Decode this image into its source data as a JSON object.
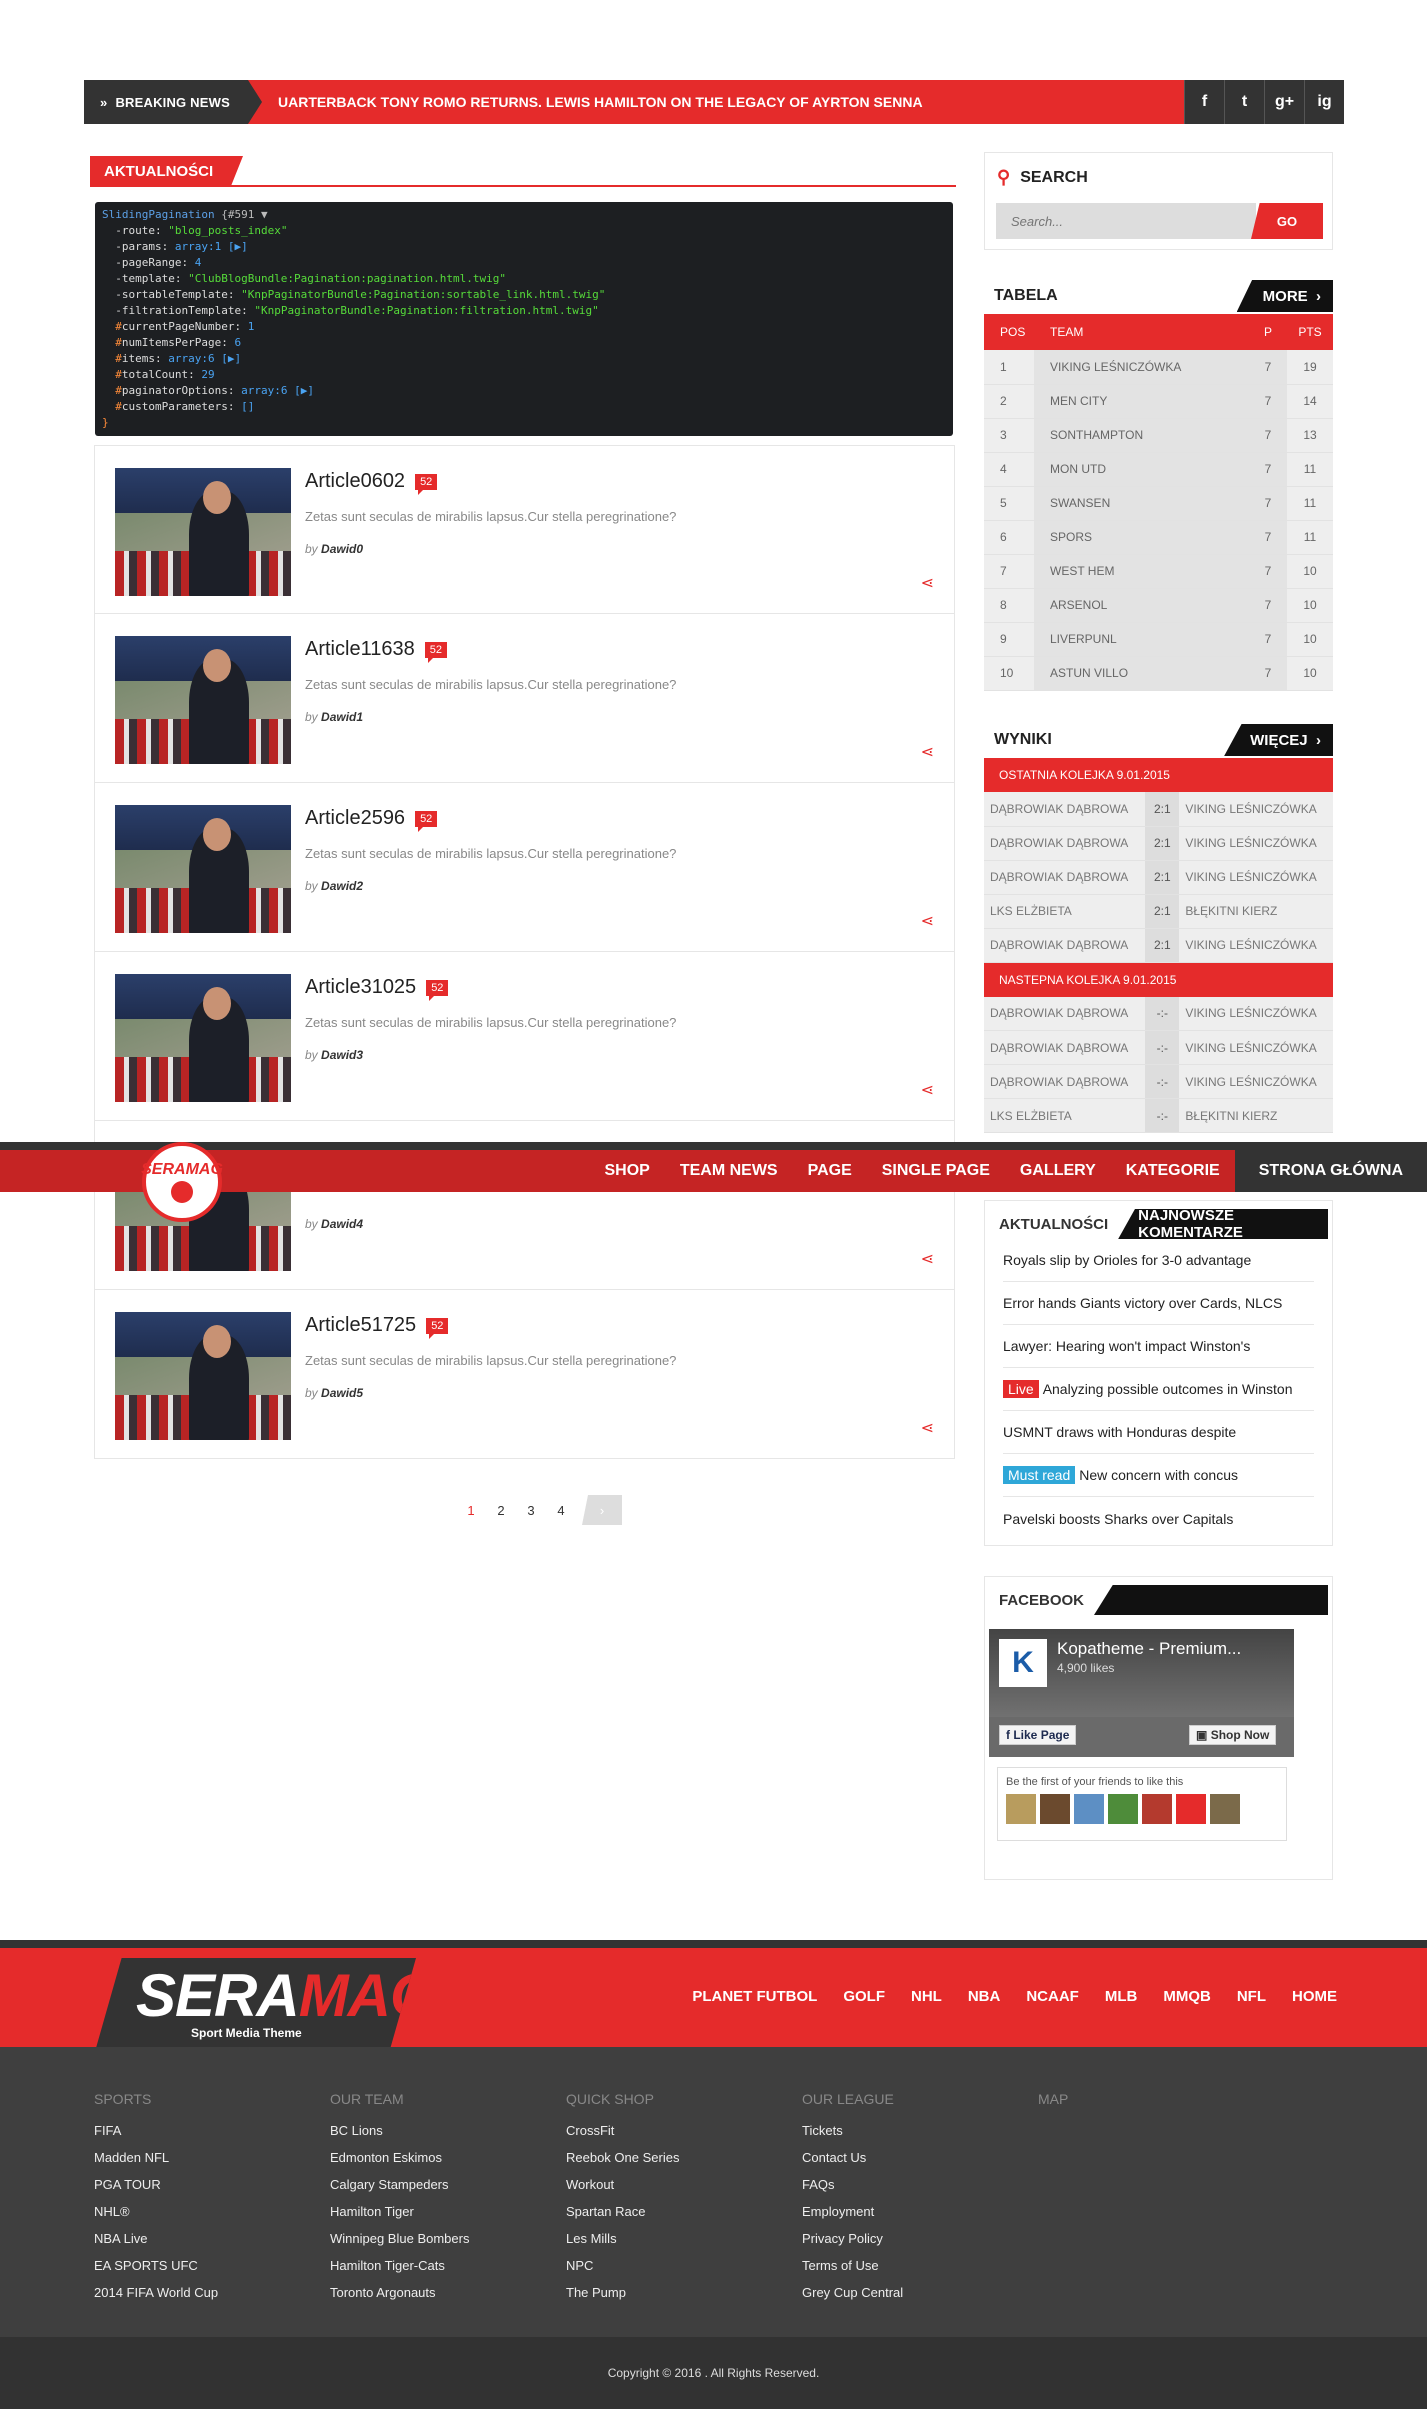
{
  "breaking": {
    "label": "BREAKING NEWS",
    "ticker": "UARTERBACK TONY ROMO RETURNS. LEWIS HAMILTON ON THE LEGACY OF AYRTON SENNA",
    "social": [
      "f",
      "t",
      "g+",
      "ig"
    ]
  },
  "main": {
    "section_title": "AKTUALNOŚCI",
    "debug": {
      "header": "SlidingPagination",
      "id": "{#591 ▼",
      "route": "\"blog_posts_index\"",
      "params": "array:1 [▶]",
      "pageRange": "4",
      "template": "\"ClubBlogBundle:Pagination:pagination.html.twig\"",
      "sortableTemplate": "\"KnpPaginatorBundle:Pagination:sortable_link.html.twig\"",
      "filtrationTemplate": "\"KnpPaginatorBundle:Pagination:filtration.html.twig\"",
      "currentPageNumber": "1",
      "numItemsPerPage": "6",
      "items": "array:6 [▶]",
      "totalCount": "29",
      "paginatorOptions": "array:6 [▶]",
      "customParameters": "[]"
    },
    "articles": [
      {
        "title": "Article0602",
        "comments": "52",
        "desc": "Zetas sunt seculas de mirabilis lapsus.Cur stella peregrinatione?",
        "by": "by",
        "author": "Dawid0"
      },
      {
        "title": "Article11638",
        "comments": "52",
        "desc": "Zetas sunt seculas de mirabilis lapsus.Cur stella peregrinatione?",
        "by": "by",
        "author": "Dawid1"
      },
      {
        "title": "Article2596",
        "comments": "52",
        "desc": "Zetas sunt seculas de mirabilis lapsus.Cur stella peregrinatione?",
        "by": "by",
        "author": "Dawid2"
      },
      {
        "title": "Article31025",
        "comments": "52",
        "desc": "Zetas sunt seculas de mirabilis lapsus.Cur stella peregrinatione?",
        "by": "by",
        "author": "Dawid3"
      },
      {
        "title": "",
        "comments": "",
        "desc": "",
        "by": "by",
        "author": "Dawid4"
      },
      {
        "title": "Article51725",
        "comments": "52",
        "desc": "Zetas sunt seculas de mirabilis lapsus.Cur stella peregrinatione?",
        "by": "by",
        "author": "Dawid5"
      }
    ],
    "pagination": [
      "1",
      "2",
      "3",
      "4"
    ]
  },
  "search": {
    "title": "SEARCH",
    "placeholder": "Search...",
    "button": "GO"
  },
  "table": {
    "title": "TABELA",
    "more": "MORE",
    "headers": [
      "POS",
      "TEAM",
      "P",
      "PTS"
    ],
    "rows": [
      [
        "1",
        "VIKING LEŚNICZÓWKA",
        "7",
        "19"
      ],
      [
        "2",
        "MEN CITY",
        "7",
        "14"
      ],
      [
        "3",
        "SONTHAMPTON",
        "7",
        "13"
      ],
      [
        "4",
        "MON UTD",
        "7",
        "11"
      ],
      [
        "5",
        "SWANSEN",
        "7",
        "11"
      ],
      [
        "6",
        "SPORS",
        "7",
        "11"
      ],
      [
        "7",
        "WEST HEM",
        "7",
        "10"
      ],
      [
        "8",
        "ARSENOL",
        "7",
        "10"
      ],
      [
        "9",
        "LIVERPUNL",
        "7",
        "10"
      ],
      [
        "10",
        "ASTUN VILLO",
        "7",
        "10"
      ]
    ]
  },
  "results": {
    "title": "WYNIKI",
    "more": "WIĘCEJ",
    "last_round": "OSTATNIA KOLEJKA 9.01.2015",
    "last": [
      [
        "DĄBROWIAK DĄBROWA",
        "2:1",
        "VIKING LEŚNICZÓWKA"
      ],
      [
        "DĄBROWIAK DĄBROWA",
        "2:1",
        "VIKING LEŚNICZÓWKA"
      ],
      [
        "DĄBROWIAK DĄBROWA",
        "2:1",
        "VIKING LEŚNICZÓWKA"
      ],
      [
        "LKS ELŻBIETA",
        "2:1",
        "BŁĘKITNI KIERZ"
      ],
      [
        "DĄBROWIAK DĄBROWA",
        "2:1",
        "VIKING LEŚNICZÓWKA"
      ]
    ],
    "next_round": "NASTEPNA KOLEJKA 9.01.2015",
    "next": [
      [
        "DĄBROWIAK DĄBROWA",
        "-:-",
        "VIKING LEŚNICZÓWKA"
      ],
      [
        "DĄBROWIAK DĄBROWA",
        "-:-",
        "VIKING LEŚNICZÓWKA"
      ],
      [
        "DĄBROWIAK DĄBROWA",
        "-:-",
        "VIKING LEŚNICZÓWKA"
      ],
      [
        "LKS ELŻBIETA",
        "-:-",
        "BŁĘKITNI KIERZ"
      ]
    ]
  },
  "nav": {
    "logo": "SERAMAG",
    "items": [
      "SHOP",
      "TEAM NEWS",
      "PAGE",
      "SINGLE PAGE",
      "GALLERY",
      "KATEGORIE",
      "STRONA GŁÓWNA"
    ]
  },
  "news_widget": {
    "tab1": "AKTUALNOŚCI",
    "tab2": "NAJNOWSZE KOMENTARZE",
    "items": [
      {
        "tag": "",
        "text": "Royals slip by Orioles for 3-0 advantage"
      },
      {
        "tag": "",
        "text": "Error hands Giants victory over Cards, NLCS"
      },
      {
        "tag": "",
        "text": "Lawyer: Hearing won't impact Winston's"
      },
      {
        "tag": "Live",
        "text": "Analyzing possible outcomes in Winston"
      },
      {
        "tag": "",
        "text": "USMNT draws with Honduras despite"
      },
      {
        "tag": "Must read",
        "text": "New concern with concus"
      },
      {
        "tag": "",
        "text": "Pavelski boosts Sharks over Capitals"
      }
    ]
  },
  "facebook": {
    "title": "FACEBOOK",
    "page_name": "Kopatheme - Premium...",
    "likes": "4,900 likes",
    "like_btn": "Like Page",
    "shop_btn": "Shop Now",
    "friends_text": "Be the first of your friends to like this"
  },
  "footer": {
    "logo_a": "SERA",
    "logo_b": "MAG",
    "tagline": "Sport Media Theme",
    "nav": [
      "PLANET FUTBOL",
      "GOLF",
      "NHL",
      "NBA",
      "NCAAF",
      "MLB",
      "MMQB",
      "NFL",
      "HOME"
    ],
    "cols": [
      {
        "title": "SPORTS",
        "items": [
          "FIFA",
          "Madden NFL",
          "PGA TOUR",
          "NHL®",
          "NBA Live",
          "EA SPORTS UFC",
          "2014 FIFA World Cup"
        ]
      },
      {
        "title": "OUR TEAM",
        "items": [
          "BC Lions",
          "Edmonton Eskimos",
          "Calgary Stampeders",
          "Hamilton Tiger",
          "Winnipeg Blue Bombers",
          "Hamilton Tiger-Cats",
          "Toronto Argonauts"
        ]
      },
      {
        "title": "QUICK SHOP",
        "items": [
          "CrossFit",
          "Reebok One Series",
          "Workout",
          "Spartan Race",
          "Les Mills",
          "NPC",
          "The Pump"
        ]
      },
      {
        "title": "OUR LEAGUE",
        "items": [
          "Tickets",
          "Contact Us",
          "FAQs",
          "Employment",
          "Privacy Policy",
          "Terms of Use",
          "Grey Cup Central"
        ]
      },
      {
        "title": "MAP",
        "items": []
      }
    ],
    "copyright": "Copyright © 2016 . All Rights Reserved."
  },
  "colors": {
    "accent": "#e52b2b",
    "dark": "#333333",
    "footer": "#3f3f3f"
  }
}
